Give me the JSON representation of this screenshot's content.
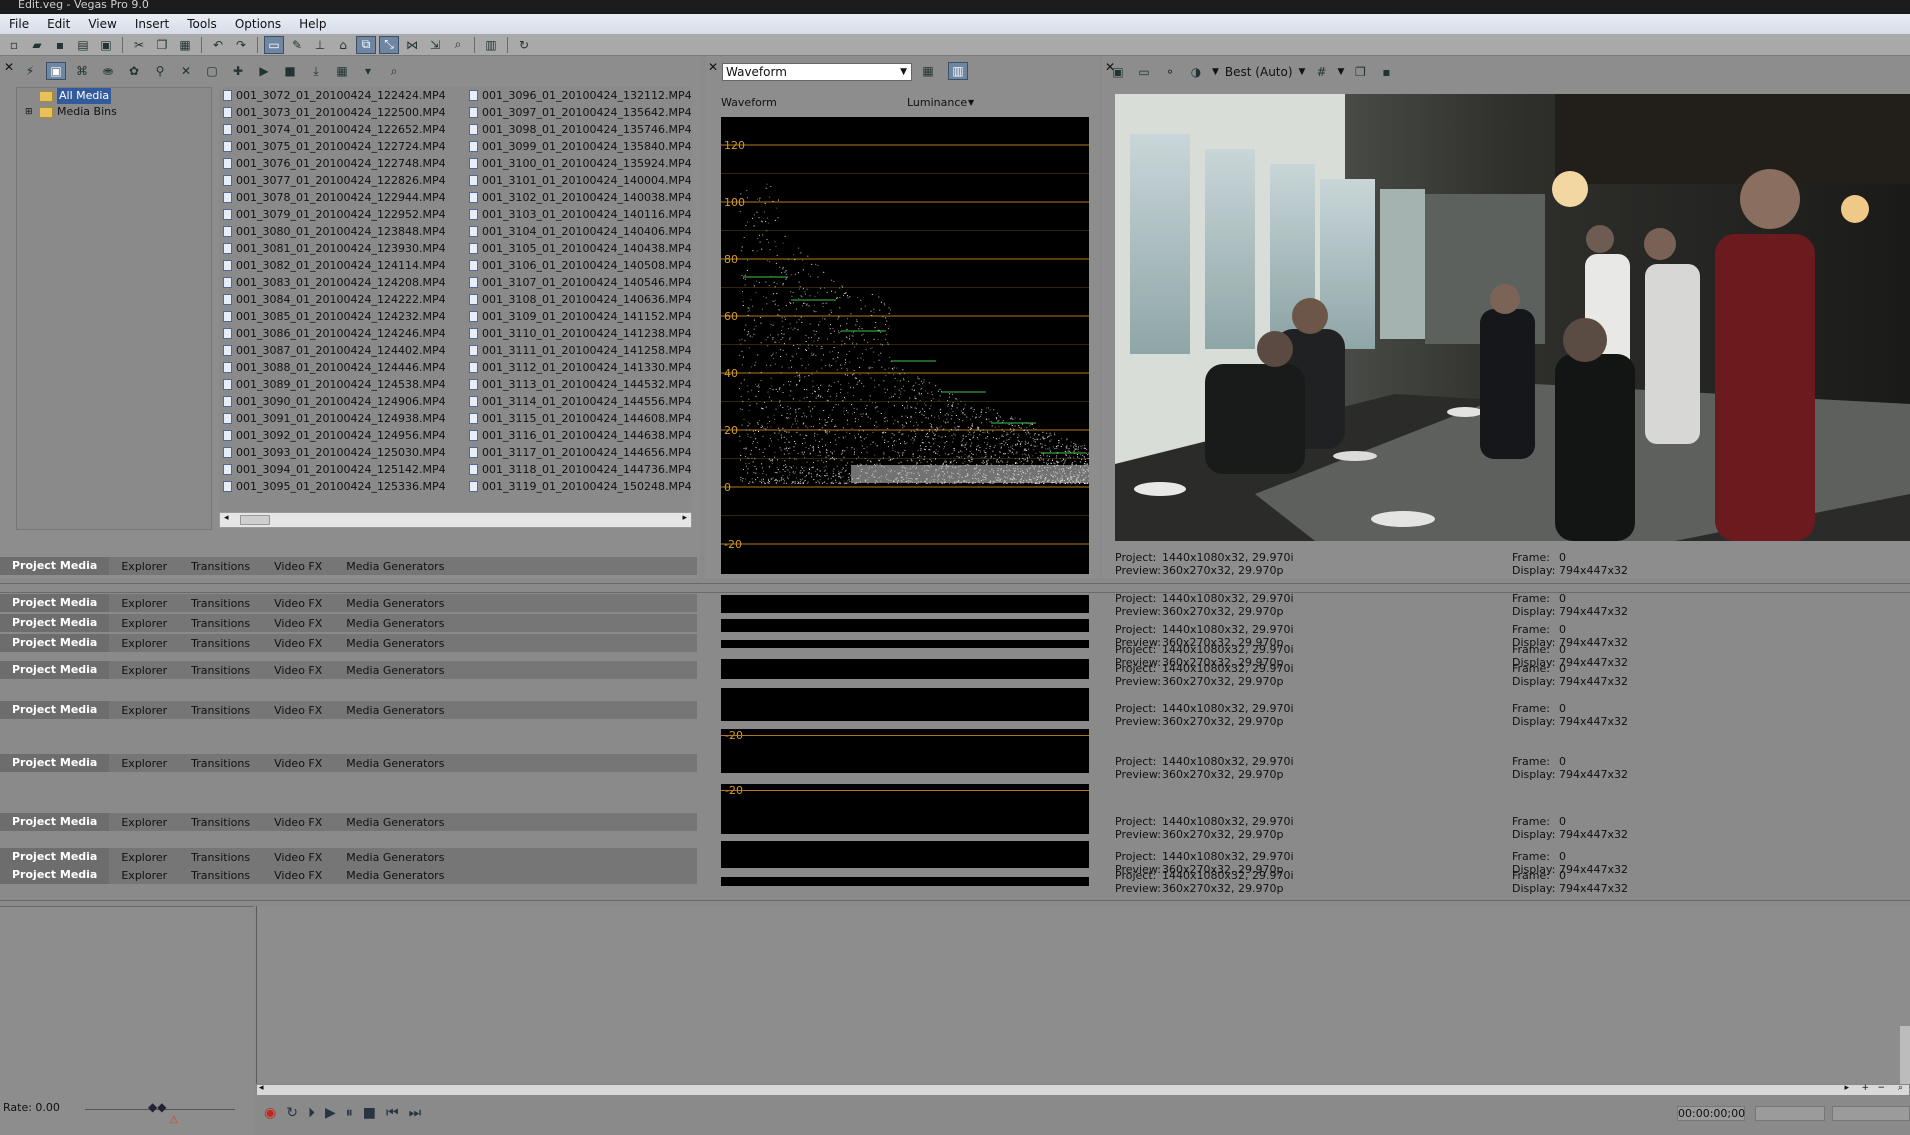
{
  "window": {
    "title": "Edit.veg - Vegas Pro 9.0"
  },
  "menu": [
    "File",
    "Edit",
    "View",
    "Insert",
    "Tools",
    "Options",
    "Help"
  ],
  "tree": {
    "all_media": "All Media",
    "media_bins": "Media Bins"
  },
  "files_col1": [
    "001_3072_01_20100424_122424.MP4",
    "001_3073_01_20100424_122500.MP4",
    "001_3074_01_20100424_122652.MP4",
    "001_3075_01_20100424_122724.MP4",
    "001_3076_01_20100424_122748.MP4",
    "001_3077_01_20100424_122826.MP4",
    "001_3078_01_20100424_122944.MP4",
    "001_3079_01_20100424_122952.MP4",
    "001_3080_01_20100424_123848.MP4",
    "001_3081_01_20100424_123930.MP4",
    "001_3082_01_20100424_124114.MP4",
    "001_3083_01_20100424_124208.MP4",
    "001_3084_01_20100424_124222.MP4",
    "001_3085_01_20100424_124232.MP4",
    "001_3086_01_20100424_124246.MP4",
    "001_3087_01_20100424_124402.MP4",
    "001_3088_01_20100424_124446.MP4",
    "001_3089_01_20100424_124538.MP4",
    "001_3090_01_20100424_124906.MP4",
    "001_3091_01_20100424_124938.MP4",
    "001_3092_01_20100424_124956.MP4",
    "001_3093_01_20100424_125030.MP4",
    "001_3094_01_20100424_125142.MP4",
    "001_3095_01_20100424_125336.MP4"
  ],
  "files_col2": [
    "001_3096_01_20100424_132112.MP4",
    "001_3097_01_20100424_135642.MP4",
    "001_3098_01_20100424_135746.MP4",
    "001_3099_01_20100424_135840.MP4",
    "001_3100_01_20100424_135924.MP4",
    "001_3101_01_20100424_140004.MP4",
    "001_3102_01_20100424_140038.MP4",
    "001_3103_01_20100424_140116.MP4",
    "001_3104_01_20100424_140406.MP4",
    "001_3105_01_20100424_140438.MP4",
    "001_3106_01_20100424_140508.MP4",
    "001_3107_01_20100424_140546.MP4",
    "001_3108_01_20100424_140636.MP4",
    "001_3109_01_20100424_141152.MP4",
    "001_3110_01_20100424_141238.MP4",
    "001_3111_01_20100424_141258.MP4",
    "001_3112_01_20100424_141330.MP4",
    "001_3113_01_20100424_144532.MP4",
    "001_3114_01_20100424_144556.MP4",
    "001_3115_01_20100424_144608.MP4",
    "001_3116_01_20100424_144638.MP4",
    "001_3117_01_20100424_144656.MP4",
    "001_3118_01_20100424_144736.MP4",
    "001_3119_01_20100424_150248.MP4"
  ],
  "tabs": [
    "Project Media",
    "Explorer",
    "Transitions",
    "Video FX",
    "Media Generators"
  ],
  "scope": {
    "selector": "Waveform",
    "label": "Waveform",
    "mode": "Luminance",
    "ticks": [
      "120",
      "100",
      "80",
      "60",
      "40",
      "20",
      "0",
      "-20"
    ],
    "small_tick": "-20"
  },
  "preview": {
    "quality": "Best (Auto)"
  },
  "info": {
    "project_label": "Project:",
    "project_value": "1440x1080x32, 29.970i",
    "preview_label": "Preview:",
    "preview_value": "360x270x32, 29.970p",
    "frame_label": "Frame:",
    "frame_value": "0",
    "display_label": "Display:",
    "display_value": "794x447x32"
  },
  "timeline": {
    "rate": "Rate: 0.00",
    "timecode": "00:00:00;00"
  },
  "colors": {
    "scope_graticule": "#b07a1c",
    "scope_trace": "#ffffff",
    "selection": "#335b9c"
  }
}
